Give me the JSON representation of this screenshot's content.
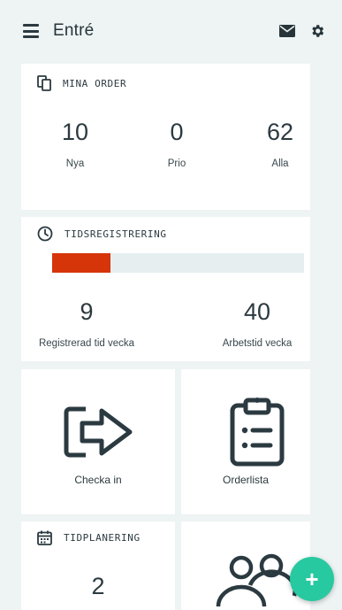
{
  "header": {
    "title": "Entré",
    "menu_icon": "hamburger-menu-icon",
    "mail_icon": "envelope-icon",
    "settings_icon": "gear-icon"
  },
  "orders": {
    "title": "MINA ORDER",
    "stats": [
      {
        "value": "10",
        "label": "Nya"
      },
      {
        "value": "0",
        "label": "Prio"
      },
      {
        "value": "62",
        "label": "Alla"
      }
    ]
  },
  "time": {
    "title": "TIDSREGISTRERING",
    "progress": 0.23,
    "progress_color": "#d63409",
    "stats": [
      {
        "value": "9",
        "label": "Registrerad tid vecka"
      },
      {
        "value": "40",
        "label": "Arbetstid vecka"
      }
    ]
  },
  "tiles": {
    "checkin_label": "Checka in",
    "orderlist_label": "Orderlista"
  },
  "planning": {
    "title": "TIDPLANERING",
    "value": "2"
  },
  "fab": {
    "label": "+",
    "color": "#27c9a0"
  }
}
